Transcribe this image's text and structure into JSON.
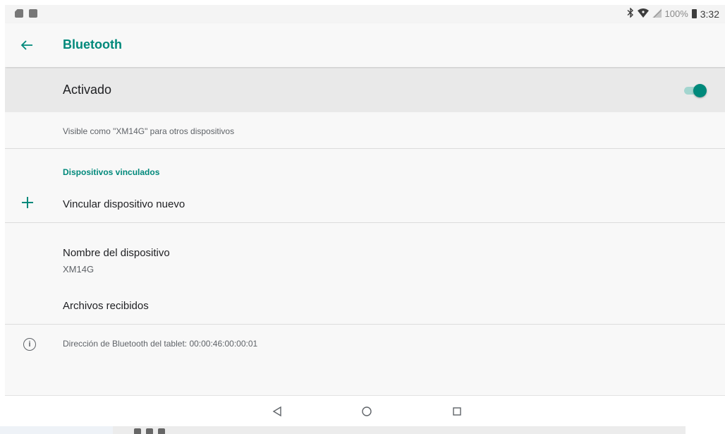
{
  "status_bar": {
    "left_icons": [
      "sd-card-icon",
      "image-icon"
    ],
    "right_icons": [
      "bluetooth-icon",
      "wifi-icon",
      "signal-icon",
      "battery-icon"
    ],
    "battery_percent": "100%",
    "time": "3:32"
  },
  "app_bar": {
    "back_icon": "arrow-back-icon",
    "title": "Bluetooth"
  },
  "toggle": {
    "label": "Activado",
    "state": "on",
    "accent_color": "#00897b"
  },
  "visible_as": "Visible como \"XM14G\" para otros dispositivos",
  "paired_section": {
    "header": "Dispositivos vinculados",
    "pair_new_label": "Vincular dispositivo nuevo",
    "pair_icon": "plus-icon"
  },
  "device_name": {
    "title": "Nombre del dispositivo",
    "value": "XM14G"
  },
  "received_files": {
    "label": "Archivos recibidos"
  },
  "info": {
    "icon": "info-icon",
    "text": "Dirección de Bluetooth del tablet: 00:00:46:00:00:01"
  },
  "nav_bar": {
    "buttons": [
      "nav-back-icon",
      "nav-home-icon",
      "nav-recents-icon"
    ]
  }
}
